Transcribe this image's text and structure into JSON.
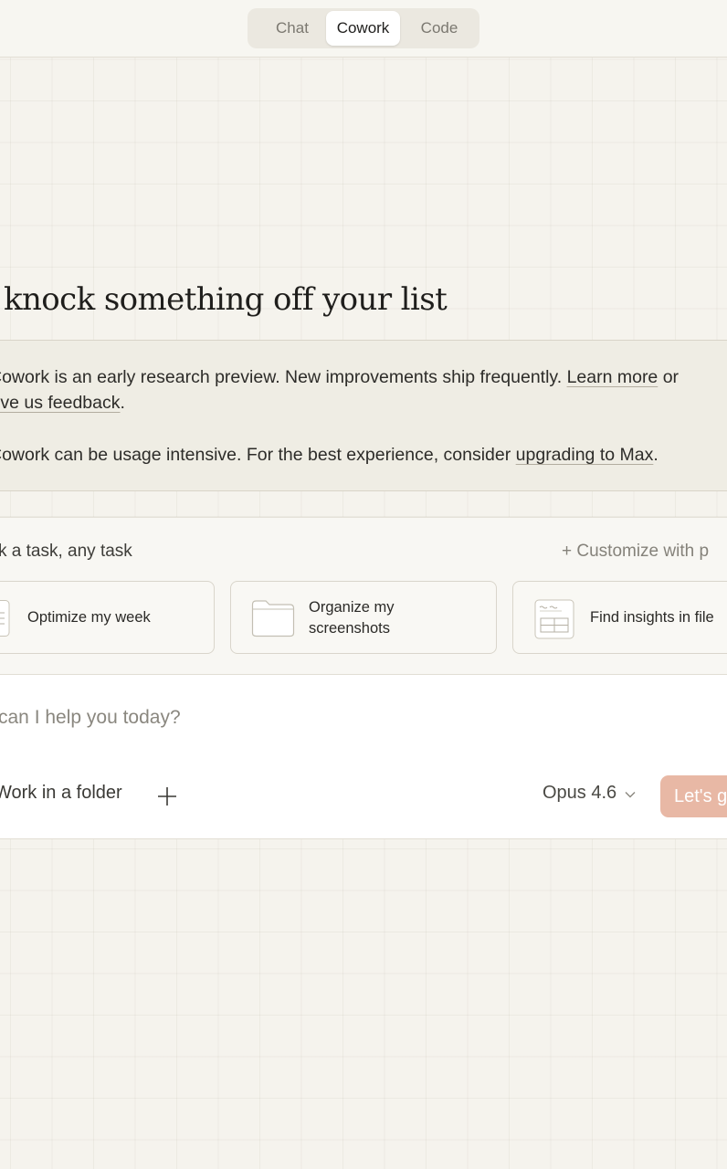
{
  "modes": {
    "tabs": [
      {
        "label": "Chat"
      },
      {
        "label": "Cowork"
      },
      {
        "label": "Code"
      }
    ],
    "active": "Cowork"
  },
  "headline": "knock something off your list",
  "notice": {
    "line1_text": "Cowork is an early research preview. New improvements ship frequently. ",
    "learn_more": "Learn more",
    "line1_tail": " or",
    "feedback_link": "ive us feedback",
    "feedback_tail": ".",
    "line2_text": "Cowork can be usage intensive. For the best experience, consider ",
    "upgrade_link": "upgrading to Max",
    "line2_tail": "."
  },
  "tasks": {
    "title": "k a task, any task",
    "customize": "+ Customize with p",
    "cards": [
      {
        "label": "Optimize my week",
        "icon": "calendar-icon"
      },
      {
        "label": "Organize my screenshots",
        "icon": "folder-icon"
      },
      {
        "label": "Find insights in file",
        "icon": "spreadsheet-icon"
      }
    ]
  },
  "composer": {
    "placeholder": "can I help you today?",
    "folder_button": "Work in a folder",
    "model": "Opus 4.6",
    "submit": "Let's g"
  },
  "colors": {
    "background": "#f5f3ed",
    "accent": "#e8b8a5",
    "notice_bg": "#efede4"
  }
}
